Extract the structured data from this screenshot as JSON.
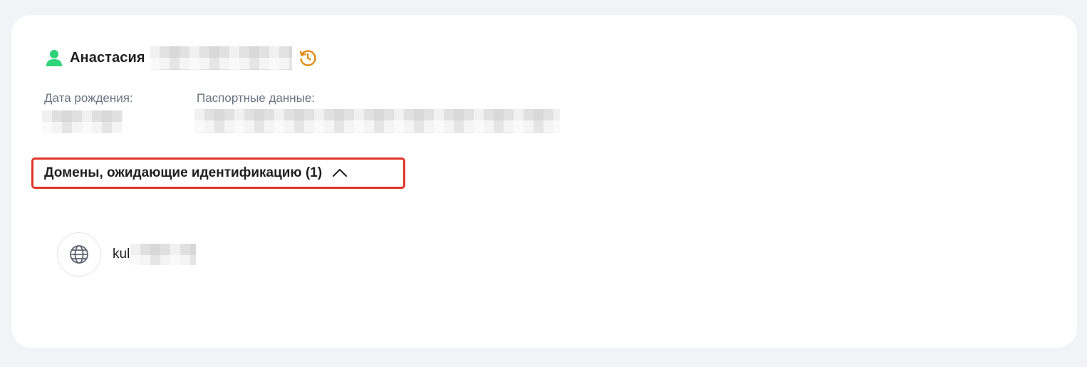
{
  "person": {
    "first_name": "Анастасия",
    "user_icon": "user-icon",
    "history_icon": "history-icon"
  },
  "fields": {
    "dob_label": "Дата рождения:",
    "passport_label": "Паспортные данные:"
  },
  "section": {
    "title": "Домены, ожидающие идентификацию (1)",
    "chevron_icon": "chevron-up-icon"
  },
  "domains": [
    {
      "visible_prefix": "kul",
      "icon": "globe-icon"
    }
  ],
  "colors": {
    "accent_green": "#2ed47a",
    "history_orange": "#e08a12",
    "highlight_red": "#e0352b"
  }
}
